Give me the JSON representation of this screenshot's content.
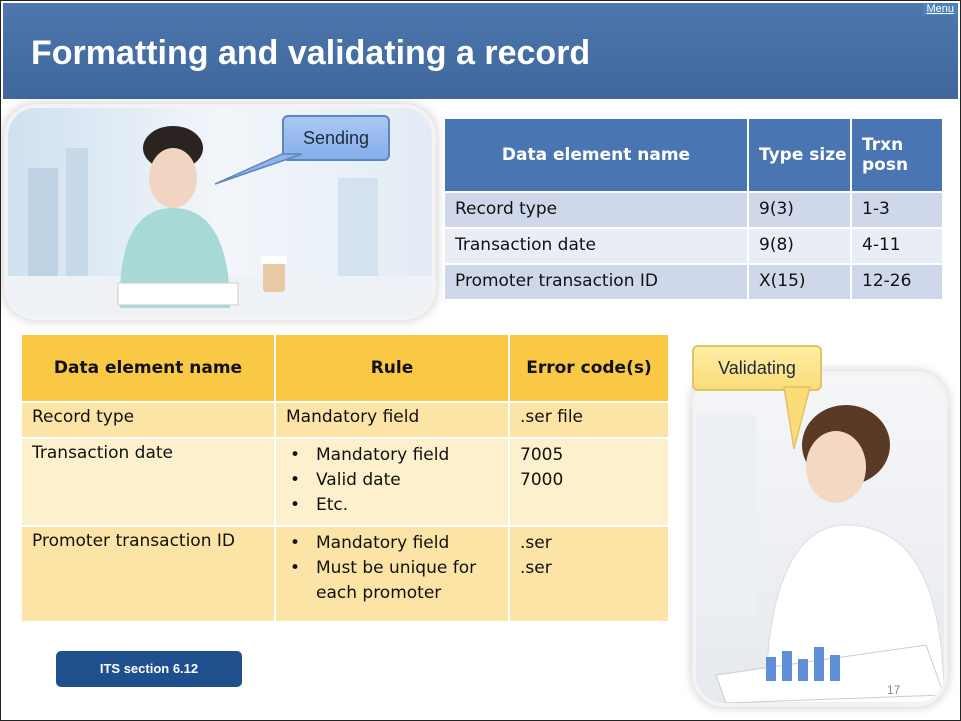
{
  "slide": {
    "title": "Formatting and validating a record",
    "menu_label": "Menu",
    "page_number": "17"
  },
  "callouts": {
    "sending": "Sending",
    "validating": "Validating"
  },
  "format_table": {
    "headers": [
      "Data element name",
      "Type size",
      "Trxn posn"
    ],
    "rows": [
      [
        "Record type",
        "9(3)",
        "1-3"
      ],
      [
        "Transaction date",
        "9(8)",
        "4-11"
      ],
      [
        "Promoter transaction ID",
        "X(15)",
        "12-26"
      ]
    ]
  },
  "validation_table": {
    "headers": [
      "Data element name",
      "Rule",
      "Error code(s)"
    ],
    "rows": [
      {
        "name": "Record type",
        "rule": "Mandatory field",
        "codes": [
          ".ser file"
        ]
      },
      {
        "name": "Transaction date",
        "rules": [
          "Mandatory field",
          "Valid date",
          "Etc."
        ],
        "codes": [
          "7005",
          "7000"
        ]
      },
      {
        "name": "Promoter transaction ID",
        "rules": [
          "Mandatory field",
          "Must be unique for each promoter"
        ],
        "codes": [
          ".ser",
          ".ser"
        ]
      }
    ]
  },
  "its_button": "ITS section 6.12",
  "colors": {
    "title_bar": "#4671a8",
    "blue_header": "#4a75b3",
    "yellow_header": "#f9c844",
    "button": "#1f4f8c"
  }
}
